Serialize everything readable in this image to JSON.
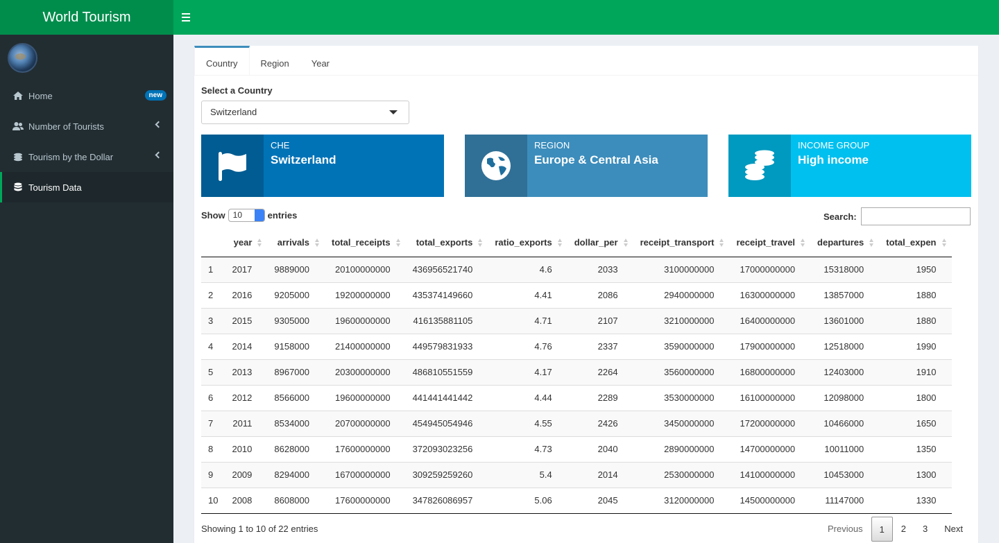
{
  "app": {
    "title": "World Tourism"
  },
  "sidebar": {
    "items": [
      {
        "label": "Home",
        "icon": "home-icon",
        "badge": "new"
      },
      {
        "label": "Number of Tourists",
        "icon": "users-icon"
      },
      {
        "label": "Tourism by the Dollar",
        "icon": "coins-icon"
      },
      {
        "label": "Tourism Data",
        "icon": "database-icon",
        "active": true
      }
    ]
  },
  "tabs": [
    "Country",
    "Region",
    "Year"
  ],
  "selector": {
    "label": "Select a Country",
    "value": "Switzerland"
  },
  "infoboxes": [
    {
      "key": "CHE",
      "value": "Switzerland",
      "icon": "flag-icon",
      "color": "#0073b7"
    },
    {
      "key": "REGION",
      "value": "Europe & Central Asia",
      "icon": "globe-icon",
      "color": "#3c8dbc"
    },
    {
      "key": "INCOME GROUP",
      "value": "High income",
      "icon": "coins-icon",
      "color": "#00c0ef"
    }
  ],
  "table_controls": {
    "show_label": "Show",
    "length": "10",
    "entries_label": "entries",
    "search_label": "Search:"
  },
  "table": {
    "columns": [
      "year",
      "arrivals",
      "total_receipts",
      "total_exports",
      "ratio_exports",
      "dollar_per",
      "receipt_transport",
      "receipt_travel",
      "departures",
      "total_expen"
    ],
    "rows": [
      [
        "1",
        "2017",
        "9889000",
        "20100000000",
        "436956521740",
        "4.6",
        "2033",
        "3100000000",
        "17000000000",
        "15318000",
        "1950"
      ],
      [
        "2",
        "2016",
        "9205000",
        "19200000000",
        "435374149660",
        "4.41",
        "2086",
        "2940000000",
        "16300000000",
        "13857000",
        "1880"
      ],
      [
        "3",
        "2015",
        "9305000",
        "19600000000",
        "416135881105",
        "4.71",
        "2107",
        "3210000000",
        "16400000000",
        "13601000",
        "1880"
      ],
      [
        "4",
        "2014",
        "9158000",
        "21400000000",
        "449579831933",
        "4.76",
        "2337",
        "3590000000",
        "17900000000",
        "12518000",
        "1990"
      ],
      [
        "5",
        "2013",
        "8967000",
        "20300000000",
        "486810551559",
        "4.17",
        "2264",
        "3560000000",
        "16800000000",
        "12403000",
        "1910"
      ],
      [
        "6",
        "2012",
        "8566000",
        "19600000000",
        "441441441442",
        "4.44",
        "2289",
        "3530000000",
        "16100000000",
        "12098000",
        "1800"
      ],
      [
        "7",
        "2011",
        "8534000",
        "20700000000",
        "454945054946",
        "4.55",
        "2426",
        "3450000000",
        "17200000000",
        "10466000",
        "1650"
      ],
      [
        "8",
        "2010",
        "8628000",
        "17600000000",
        "372093023256",
        "4.73",
        "2040",
        "2890000000",
        "14700000000",
        "10011000",
        "1350"
      ],
      [
        "9",
        "2009",
        "8294000",
        "16700000000",
        "309259259260",
        "5.4",
        "2014",
        "2530000000",
        "14100000000",
        "10453000",
        "1300"
      ],
      [
        "10",
        "2008",
        "8608000",
        "17600000000",
        "347826086957",
        "5.06",
        "2045",
        "3120000000",
        "14500000000",
        "11147000",
        "1330"
      ]
    ]
  },
  "footer": {
    "info": "Showing 1 to 10 of 22 entries",
    "pager": {
      "previous": "Previous",
      "pages": [
        "1",
        "2",
        "3"
      ],
      "current": "1",
      "next": "Next"
    }
  },
  "colors": {
    "header": "#00a65a",
    "logo": "#008d4c",
    "sidebar": "#222d32"
  }
}
